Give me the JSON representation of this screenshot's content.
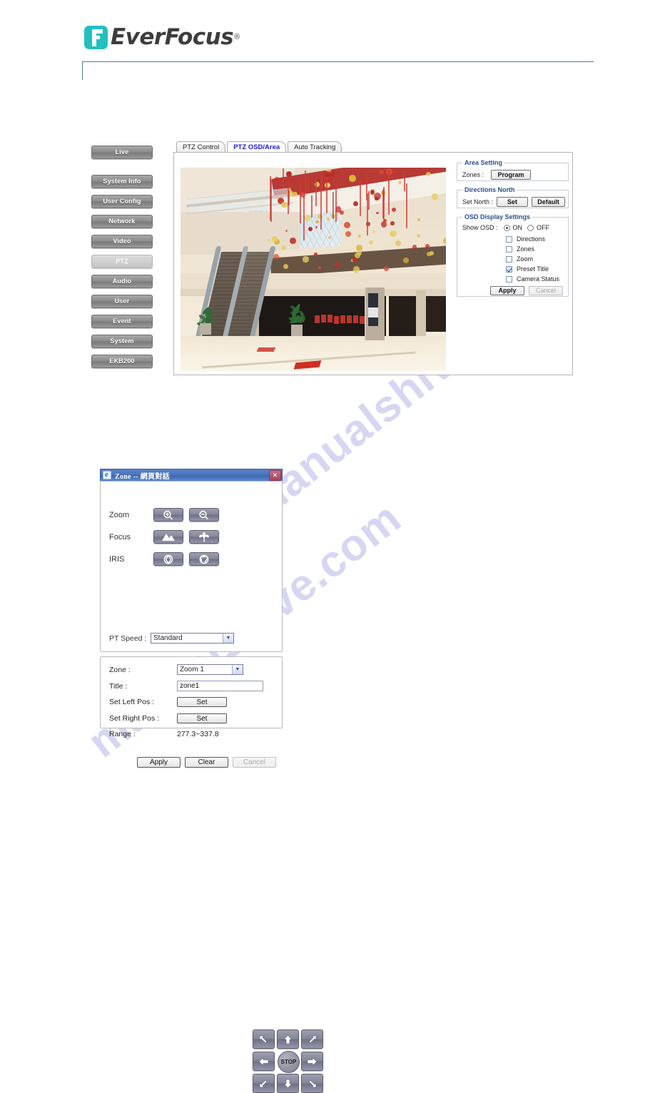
{
  "brand": {
    "name": "EverFocus",
    "registered": "®"
  },
  "watermark": {
    "text": "manualshive.com"
  },
  "sidebar": {
    "items": [
      {
        "label": "Live",
        "active": false
      },
      {
        "label": "System Info",
        "active": false
      },
      {
        "label": "User Config",
        "active": false
      },
      {
        "label": "Network",
        "active": false
      },
      {
        "label": "Video",
        "active": false
      },
      {
        "label": "PTZ",
        "active": true
      },
      {
        "label": "Audio",
        "active": false
      },
      {
        "label": "User",
        "active": false
      },
      {
        "label": "Event",
        "active": false
      },
      {
        "label": "System",
        "active": false
      },
      {
        "label": "EKB200",
        "active": false
      }
    ]
  },
  "tabs": [
    {
      "label": "PTZ Control",
      "active": false
    },
    {
      "label": "PTZ OSD/Area",
      "active": true
    },
    {
      "label": "Auto Tracking",
      "active": false
    }
  ],
  "area_setting": {
    "legend": "Area Setting",
    "zones_label": "Zones :",
    "program_button": "Program"
  },
  "directions_north": {
    "legend": "Directions North",
    "set_north_label": "Set North :",
    "set_button": "Set",
    "default_button": "Default"
  },
  "osd_display": {
    "legend": "OSD Display Settings",
    "show_osd_label": "Show OSD :",
    "on_label": "ON",
    "off_label": "OFF",
    "show_osd_value": "ON",
    "checkboxes": [
      {
        "label": "Directions",
        "checked": false
      },
      {
        "label": "Zones",
        "checked": false
      },
      {
        "label": "Zoom",
        "checked": false
      },
      {
        "label": "Preset Title",
        "checked": true
      },
      {
        "label": "Camera Status",
        "checked": false
      }
    ],
    "apply_button": "Apply",
    "cancel_button": "Cancel",
    "cancel_disabled": true
  },
  "dialog": {
    "title": "Zone -- 網頁對話",
    "close_label": "✕",
    "ptz": {
      "zoom_label": "Zoom",
      "focus_label": "Focus",
      "iris_label": "IRIS",
      "zoom_in_icon": "zoom-in-magnifier",
      "zoom_out_icon": "zoom-out-magnifier",
      "focus_far_icon": "mountain",
      "focus_near_icon": "flower",
      "iris_open_icon": "iris-open",
      "iris_close_icon": "iris-close",
      "stop_label": "STOP",
      "directions": [
        "up-left",
        "up",
        "up-right",
        "left",
        "stop",
        "right",
        "down-left",
        "down",
        "down-right"
      ],
      "pt_speed_label": "PT Speed :",
      "pt_speed_value": "Standard"
    },
    "form": {
      "zone_label": "Zone :",
      "zone_value": "Zoom 1",
      "title_label": "Title :",
      "title_value": "zone1",
      "set_left_label": "Set Left Pos :",
      "set_left_button": "Set",
      "set_right_label": "Set Right Pos :",
      "set_right_button": "Set",
      "range_label": "Range :",
      "range_value": "277.3~337.8"
    },
    "footer": {
      "apply_button": "Apply",
      "clear_button": "Clear",
      "cancel_button": "Cancel",
      "cancel_disabled": true
    }
  },
  "colors": {
    "brand_teal": "#23bfc0",
    "legend_blue": "#2b4f8e",
    "active_tab_blue": "#1a1ad0",
    "titlebar_blue": "#4a74bd"
  }
}
